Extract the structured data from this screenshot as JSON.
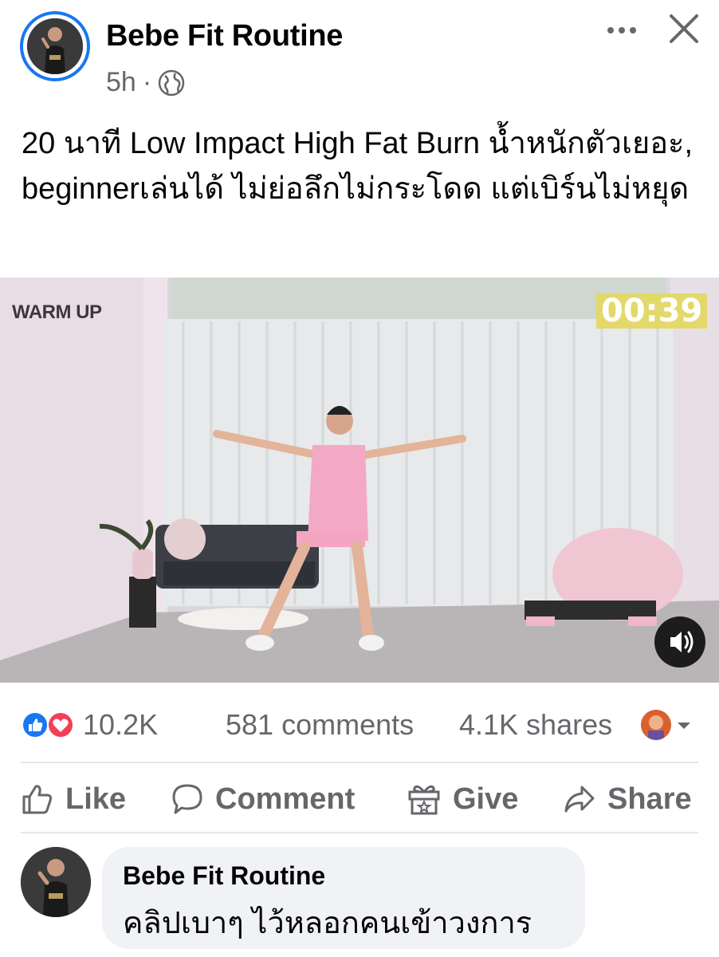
{
  "post": {
    "page_name": "Bebe Fit Routine",
    "time": "5h",
    "separator": "·",
    "audience_icon": "globe-icon",
    "caption": "20 นาที Low Impact High Fat Burn น้ำหนักตัวเยอะ, beginnerเล่นได้ ไม่ย่อลึกไม่กระโดด แต่เบิร์นไม่หยุด"
  },
  "video": {
    "section_label": "WARM UP",
    "timer": "00:39",
    "sound_icon": "speaker-icon"
  },
  "stats": {
    "reaction_icons": [
      "like-icon",
      "love-icon"
    ],
    "reactions": "10.2K",
    "comments": "581 comments",
    "shares": "4.1K shares"
  },
  "actions": {
    "like": "Like",
    "comment": "Comment",
    "give": "Give",
    "share": "Share"
  },
  "comment": {
    "author": "Bebe Fit Routine",
    "text": "คลิปเบาๆ ไว้หลอกคนเข้าวงการ"
  },
  "colors": {
    "brand": "#1877f2",
    "secondary_text": "#65676b",
    "timer_bg": "#e2d96a",
    "love": "#f33e58"
  }
}
